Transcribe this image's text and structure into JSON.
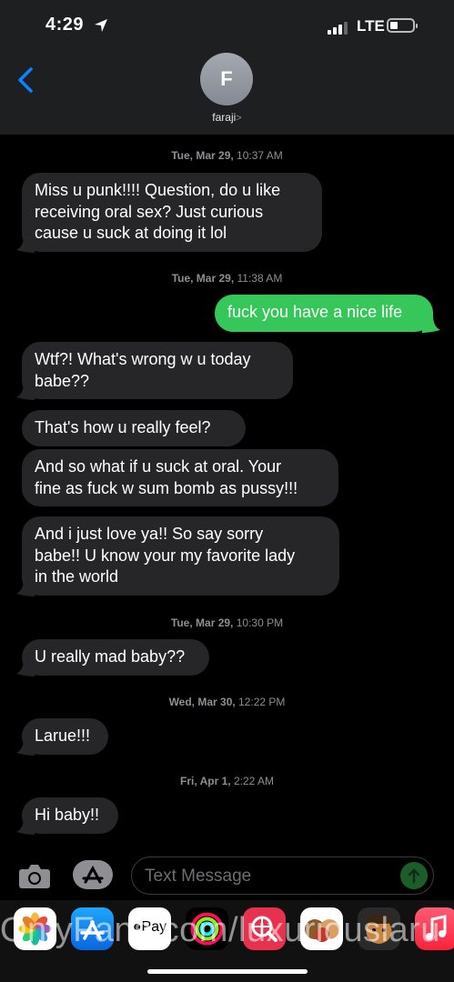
{
  "status_bar": {
    "time": "4:29",
    "network": "LTE"
  },
  "contact": {
    "initial": "F",
    "name": "faraji",
    "chevron": ">"
  },
  "timestamps": [
    {
      "day": "Tue, Mar 29,",
      "time": "10:37 AM"
    },
    {
      "day": "Tue, Mar 29,",
      "time": "11:38 AM"
    },
    {
      "day": "Tue, Mar 29,",
      "time": "10:30 PM"
    },
    {
      "day": "Wed, Mar 30,",
      "time": "12:22 PM"
    },
    {
      "day": "Fri, Apr 1,",
      "time": "2:22 AM"
    }
  ],
  "messages": [
    {
      "direction": "incoming",
      "lines": [
        "Miss u punk!!!! Question, do u like",
        "receiving oral sex? Just curious",
        "cause u suck at doing it lol"
      ]
    },
    {
      "direction": "outgoing",
      "lines": [
        "fuck you have a nice life"
      ]
    },
    {
      "direction": "incoming",
      "lines": [
        "Wtf?! What's wrong w u today",
        "babe??"
      ]
    },
    {
      "direction": "incoming",
      "lines": [
        "That's how u really feel?"
      ]
    },
    {
      "direction": "incoming",
      "lines": [
        "And so what if u suck at oral. Your",
        "fine as fuck w sum bomb as pussy!!!"
      ]
    },
    {
      "direction": "incoming",
      "lines": [
        "And i just love ya!! So say sorry",
        "babe!! U know your my favorite lady",
        "in the world"
      ]
    },
    {
      "direction": "incoming",
      "lines": [
        "U really mad baby??"
      ]
    },
    {
      "direction": "incoming",
      "lines": [
        "Larue!!!"
      ]
    },
    {
      "direction": "incoming",
      "lines": [
        "Hi baby!!"
      ]
    }
  ],
  "composer": {
    "placeholder": "Text Message"
  },
  "dock": {
    "apple_pay_label": "Pay",
    "apps": [
      "photos-app",
      "app-store-app",
      "apple-pay-app",
      "activity-app",
      "search-web-app",
      "memoji-stickers-app",
      "memoji-app",
      "music-app"
    ]
  },
  "watermark": "OnlyFans.com/luxuriouslaru"
}
